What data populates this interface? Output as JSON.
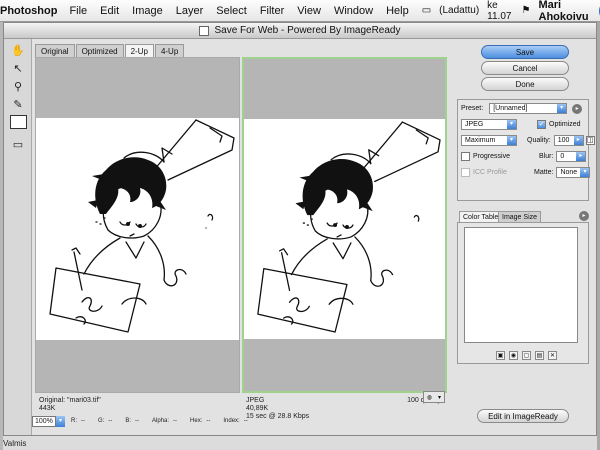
{
  "menubar": {
    "apple_icon": "apple-icon",
    "app_name": "Photoshop",
    "items": [
      "File",
      "Edit",
      "Image",
      "Layer",
      "Select",
      "Filter",
      "View",
      "Window",
      "Help"
    ],
    "battery": "(Ladattu)",
    "clock": "ke 11.07",
    "user": "Mari Ahokoivu"
  },
  "window": {
    "title": "Save For Web - Powered By ImageReady"
  },
  "tabs": [
    "Original",
    "Optimized",
    "2-Up",
    "4-Up"
  ],
  "active_tab": "2-Up",
  "panes": {
    "left": {
      "line1": "Original: \"mari03.tif\"",
      "line2": "443K"
    },
    "right": {
      "line1": "JPEG",
      "line2": "40,89K",
      "line3": "15 sec @ 28.8 Kbps",
      "quality_note": "100 quality"
    }
  },
  "buttons": {
    "save": "Save",
    "cancel": "Cancel",
    "done": "Done",
    "edit_imageready": "Edit in ImageReady"
  },
  "settings": {
    "preset_label": "Preset:",
    "preset_value": "[Unnamed]",
    "format": "JPEG",
    "optimized_label": "Optimized",
    "optimized_checked": true,
    "compression": "Maximum",
    "quality_label": "Quality:",
    "quality_value": "100",
    "progressive_label": "Progressive",
    "blur_label": "Blur:",
    "blur_value": "0",
    "icc_label": "ICC Profile",
    "matte_label": "Matte:",
    "matte_value": "None"
  },
  "panel_tabs": [
    "Color Table",
    "Image Size"
  ],
  "status": {
    "zoom": "100%",
    "r": "R:",
    "r_val": "--",
    "g": "G:",
    "g_val": "--",
    "b": "B:",
    "b_val": "--",
    "alpha": "Alpha:",
    "alpha_val": "--",
    "hex": "Hex:",
    "hex_val": "--",
    "index": "Index:",
    "index_val": "--"
  },
  "footer_status": "Valmis",
  "colors": {
    "accent_blue": "#3c7fd8",
    "pane_selection": "#9fd28c",
    "gray_matte": "#b5b5b5"
  }
}
